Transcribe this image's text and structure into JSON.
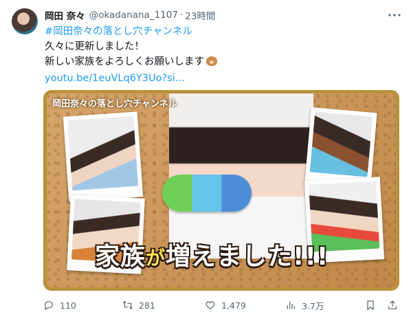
{
  "author": {
    "display_name": "岡田 奈々",
    "handle": "@okadanana_1107",
    "separator": "·",
    "time": "23時間"
  },
  "tweet": {
    "hashtag": "#岡田奈々の落とし穴チャンネル",
    "line1": "久々に更新しました！",
    "line2": "新しい家族をよろしくお願いします",
    "emoji": "dog-face-icon",
    "link": "youtu.be/1euVLq6Y3Uo?si..."
  },
  "media": {
    "overlay_title": "岡田奈々の落とし穴チャンネル",
    "caption_part1": "家族",
    "caption_part2": "が",
    "caption_part3": "増えました!!!",
    "colors": {
      "frame": "#b8913a",
      "cork": "#c89a5c"
    }
  },
  "actions": {
    "reply_count": "110",
    "retweet_count": "281",
    "like_count": "1,479",
    "views_count": "3.7万"
  },
  "colors": {
    "link": "#1d9bf0",
    "muted": "#536471",
    "text": "#0f1419"
  }
}
